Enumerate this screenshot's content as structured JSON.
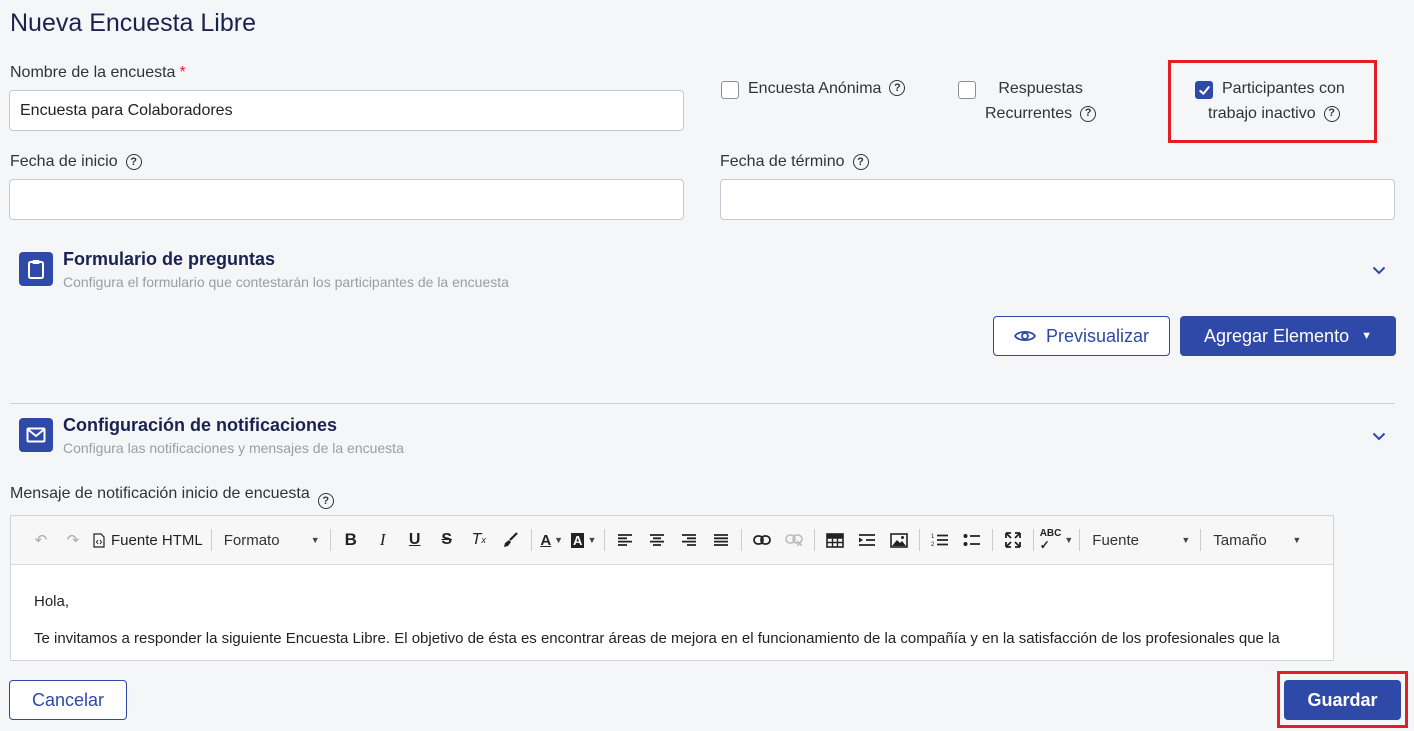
{
  "page": {
    "title": "Nueva Encuesta Libre"
  },
  "form": {
    "name_label": "Nombre de la encuesta",
    "required_mark": "*",
    "name_value": "Encuesta para Colaboradores",
    "start_label": "Fecha de inicio",
    "start_value": "",
    "end_label": "Fecha de término",
    "end_value": ""
  },
  "options": {
    "anonymous": {
      "label": "Encuesta Anónima",
      "checked": false
    },
    "recurring": {
      "label_line1": "Respuestas",
      "label_line2": "Recurrentes",
      "checked": false
    },
    "inactive": {
      "label_line1": "Participantes con",
      "label_line2": "trabajo inactivo",
      "checked": true
    }
  },
  "questions_section": {
    "title": "Formulario de preguntas",
    "subtitle": "Configura el formulario que contestarán los participantes de la encuesta",
    "preview_label": "Previsualizar",
    "add_label": "Agregar Elemento"
  },
  "notifications_section": {
    "title": "Configuración de notificaciones",
    "subtitle": "Configura las notificaciones y mensajes de la encuesta",
    "message_label": "Mensaje de notificación inicio de encuesta"
  },
  "editor": {
    "source_label": "Fuente HTML",
    "format_label": "Formato",
    "font_label": "Fuente",
    "size_label": "Tamaño",
    "body_line1": "Hola,",
    "body_line2": "Te invitamos a responder la siguiente Encuesta Libre. El objetivo de ésta es encontrar áreas de mejora en el funcionamiento de la compañía y en la satisfacción de los profesionales que la"
  },
  "footer": {
    "cancel_label": "Cancelar",
    "save_label": "Guardar"
  },
  "colors": {
    "primary": "#2e49a8",
    "title": "#1b2250",
    "highlight": "#e31e25"
  }
}
